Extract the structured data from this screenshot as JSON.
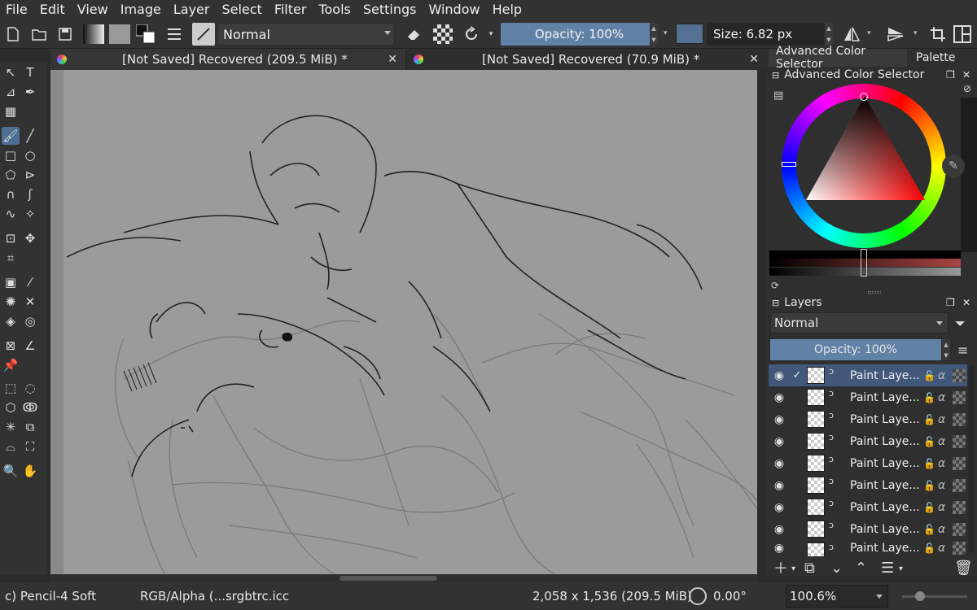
{
  "menubar": [
    "File",
    "Edit",
    "View",
    "Image",
    "Layer",
    "Select",
    "Filter",
    "Tools",
    "Settings",
    "Window",
    "Help"
  ],
  "toolbar": {
    "blend_mode": "Normal",
    "opacity": "Opacity: 100%",
    "size": "Size: 6.82 px",
    "foreground_color": "#547193"
  },
  "tabs": [
    {
      "label": "[Not Saved]  Recovered (209.5 MiB) *"
    },
    {
      "label": "[Not Saved]  Recovered (70.9 MiB) *"
    }
  ],
  "dock": {
    "tabs": [
      "Advanced Color Selector",
      "Palette"
    ],
    "color_panel_title": "Advanced Color Selector",
    "layers_title": "Layers",
    "layers_mode": "Normal",
    "layers_opacity": "Opacity: 100%",
    "layers": [
      {
        "name": "Paint Laye...",
        "visible": true,
        "selected": true
      },
      {
        "name": "Paint Laye...",
        "visible": true,
        "selected": false
      },
      {
        "name": "Paint Laye...",
        "visible": true,
        "selected": false
      },
      {
        "name": "Paint Laye...",
        "visible": true,
        "selected": false
      },
      {
        "name": "Paint Laye...",
        "visible": true,
        "selected": false
      },
      {
        "name": "Paint Laye...",
        "visible": true,
        "selected": false
      },
      {
        "name": "Paint Laye...",
        "visible": true,
        "selected": false
      },
      {
        "name": "Paint Laye...",
        "visible": true,
        "selected": false
      },
      {
        "name": "Paint Laye...",
        "visible": true,
        "selected": false
      }
    ]
  },
  "status": {
    "brush": "c) Pencil-4 Soft",
    "color_space": "RGB/Alpha (...srgbtrc.icc",
    "dimensions": "2,058 x 1,536 (209.5 MiB)",
    "rotation": "0.00°",
    "zoom": "100.6%"
  },
  "colors": {
    "accent": "#6281a6",
    "canvas": "#9b9b9b",
    "selection": "#41587a"
  }
}
